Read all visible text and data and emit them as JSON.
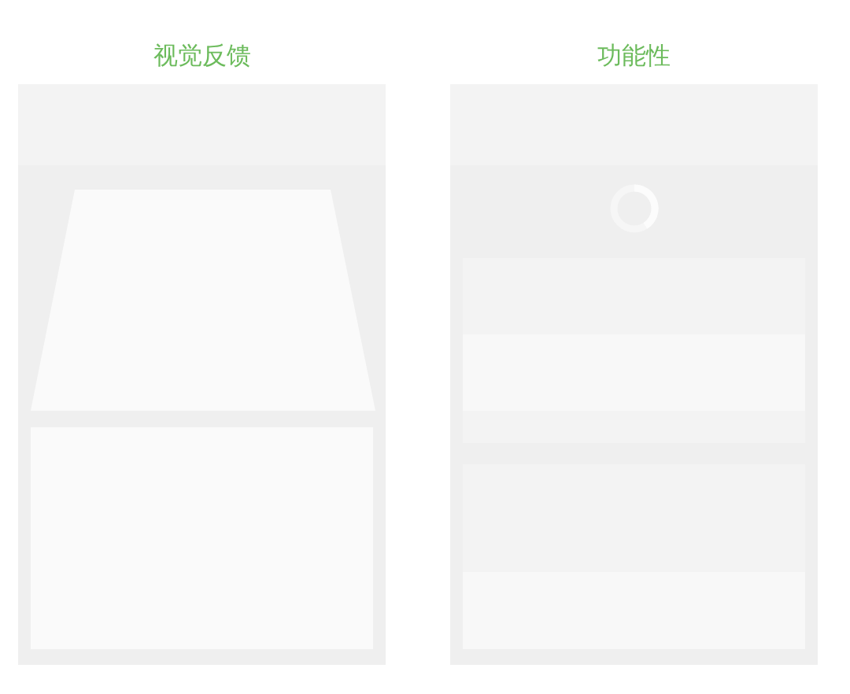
{
  "panels": [
    {
      "title": "视觉反馈",
      "kind": "shape"
    },
    {
      "title": "功能性",
      "kind": "loading"
    }
  ]
}
